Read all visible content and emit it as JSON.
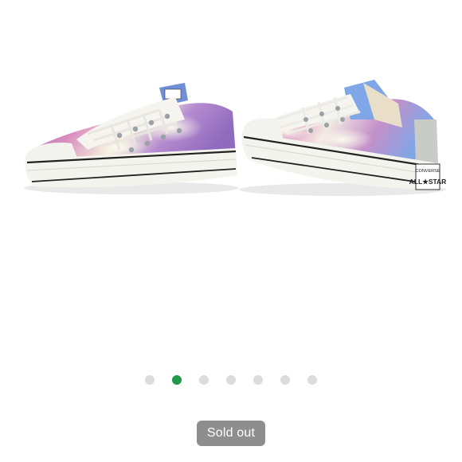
{
  "product": {
    "image_alt": "Pair of low-top canvas sneakers with purple, pink and blue tie-dye print",
    "heel_tag_brand": "CONVERSE",
    "heel_tag_model": "ALL★STAR",
    "sold_out_label": "Sold out"
  },
  "carousel": {
    "total_slides": 7,
    "active_index": 1,
    "colors": {
      "active": "#1f9a4b",
      "inactive": "#dcdcdc"
    }
  },
  "colors": {
    "badge_bg": "#8e8e8e",
    "badge_text": "#ffffff",
    "print_purple": "#9b6fc0",
    "print_pink": "#d98cbf",
    "print_blue": "#7fa6e6",
    "print_cream": "#f5f0dc"
  }
}
